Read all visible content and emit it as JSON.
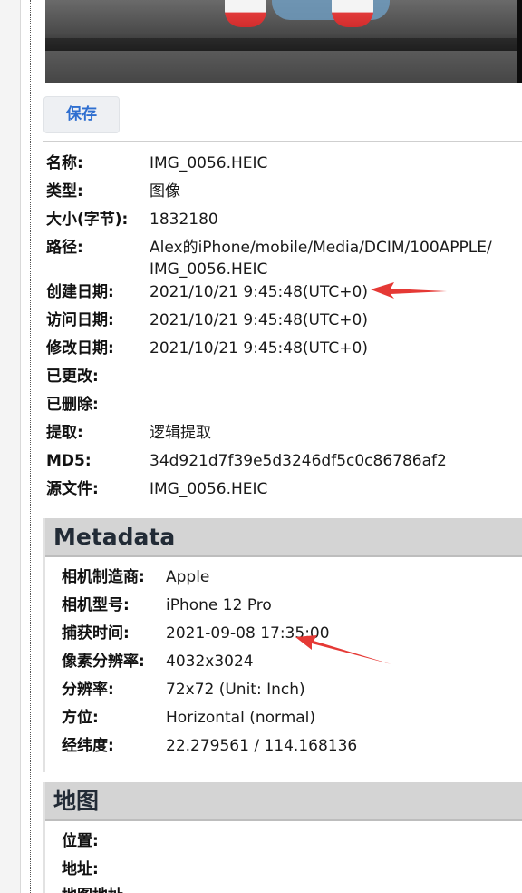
{
  "toolbar": {
    "save_label": "保存"
  },
  "file_info": [
    {
      "label": "名称:",
      "value": "IMG_0056.HEIC"
    },
    {
      "label": "类型:",
      "value": "图像"
    },
    {
      "label": "大小(字节):",
      "value": "1832180"
    },
    {
      "label": "路径:",
      "value": "Alex的iPhone/mobile/Media/DCIM/100APPLE/",
      "value2": "IMG_0056.HEIC"
    },
    {
      "label": "创建日期:",
      "value": "2021/10/21 9:45:48(UTC+0)"
    },
    {
      "label": "访问日期:",
      "value": "2021/10/21 9:45:48(UTC+0)"
    },
    {
      "label": "修改日期:",
      "value": "2021/10/21 9:45:48(UTC+0)"
    },
    {
      "label": "已更改:",
      "value": ""
    },
    {
      "label": "已删除:",
      "value": ""
    },
    {
      "label": "提取:",
      "value": "逻辑提取"
    },
    {
      "label": "MD5:",
      "value": "34d921d7f39e5d3246df5c0c86786af2"
    },
    {
      "label": "源文件:",
      "value": "IMG_0056.HEIC"
    }
  ],
  "metadata": {
    "title": "Metadata",
    "rows": [
      {
        "label": "相机制造商:",
        "value": "Apple"
      },
      {
        "label": "相机型号:",
        "value": "iPhone 12 Pro"
      },
      {
        "label": "捕获时间:",
        "value": "2021-09-08 17:35:00"
      },
      {
        "label": "像素分辨率:",
        "value": "4032x3024"
      },
      {
        "label": "分辨率:",
        "value": "72x72 (Unit: Inch)"
      },
      {
        "label": "方位:",
        "value": "Horizontal (normal)"
      },
      {
        "label": "经纬度:",
        "value": "22.279561 / 114.168136"
      }
    ]
  },
  "map": {
    "title": "地图",
    "rows": [
      {
        "label": "位置:",
        "value": ""
      },
      {
        "label": "地址:",
        "value": ""
      },
      {
        "label": "地图地址",
        "value": ""
      }
    ]
  },
  "annotations": {
    "arrow_color": "#e53935"
  }
}
